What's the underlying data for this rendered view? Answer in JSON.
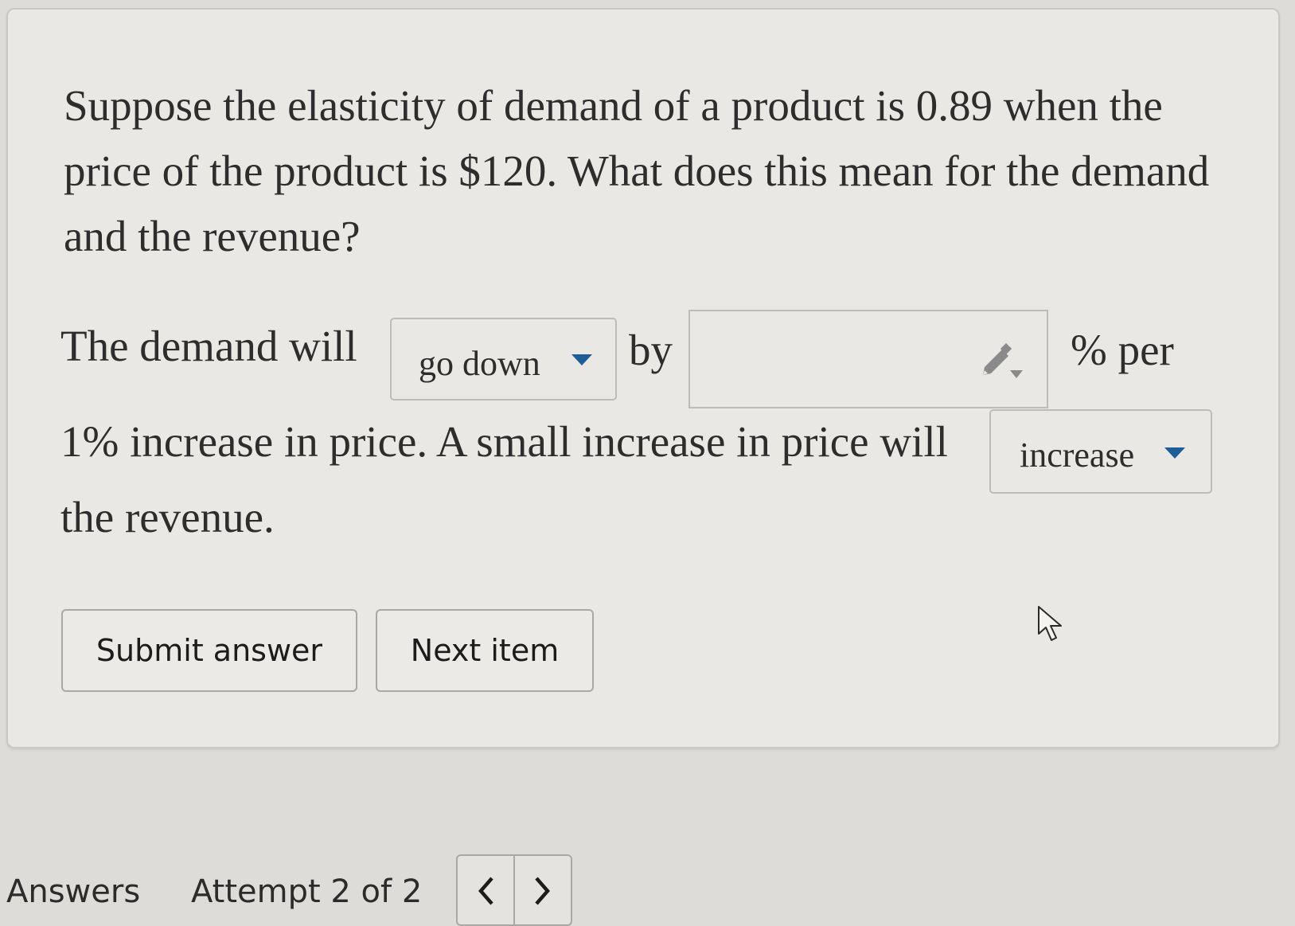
{
  "question": {
    "text": "Suppose the elasticity of demand of a product is 0.89 when the price of the product is $120. What does this mean for the demand and the revenue?"
  },
  "answer_line": {
    "demand_will": "The demand will",
    "demand_select": {
      "selected": "go down"
    },
    "by": "by",
    "percent_input": {
      "value": "",
      "icon": "pencil-dropdown-icon"
    },
    "percent_per": "% per",
    "increase_in_price": "1% increase in price. A small increase in price will",
    "revenue_select": {
      "selected": "increase"
    },
    "the_revenue": "the revenue."
  },
  "buttons": {
    "submit": "Submit answer",
    "next": "Next item"
  },
  "footer": {
    "answers": "Answers",
    "attempt": "Attempt 2 of 2",
    "prev_icon": "chevron-left-icon",
    "next_icon": "chevron-right-icon"
  },
  "colors": {
    "caret": "#1f5d99",
    "background": "#dddcd9",
    "card": "#e9e8e5"
  }
}
